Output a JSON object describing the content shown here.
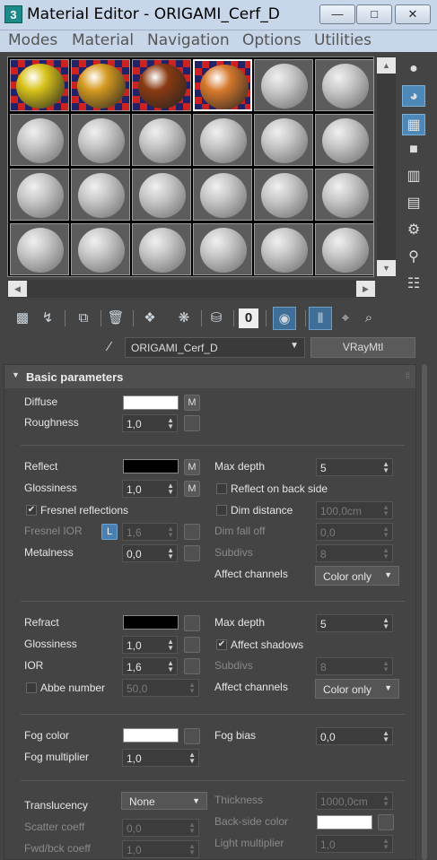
{
  "window": {
    "title": "Material Editor - ORIGAMI_Cerf_D",
    "icon": "3",
    "min": "—",
    "max": "□",
    "close": "✕"
  },
  "menu": [
    "Modes",
    "Material",
    "Navigation",
    "Options",
    "Utilities"
  ],
  "name_row": {
    "material_name": "ORIGAMI_Cerf_D",
    "material_type": "VRayMtl"
  },
  "rollout": {
    "title": "Basic parameters"
  },
  "params": {
    "diffuse": {
      "label": "Diffuse",
      "color": "#ffffff",
      "map": "M"
    },
    "roughness": {
      "label": "Roughness",
      "value": "1,0"
    },
    "reflect": {
      "label": "Reflect",
      "color": "#000000",
      "map": "M"
    },
    "glossiness": {
      "label": "Glossiness",
      "value": "1,0",
      "map": "M"
    },
    "fresnel": {
      "label": "Fresnel reflections",
      "checked": "✔"
    },
    "fresnel_ior": {
      "label": "Fresnel IOR",
      "lock": "L",
      "value": "1,6"
    },
    "metalness": {
      "label": "Metalness",
      "value": "0,0"
    },
    "refl_max_depth": {
      "label": "Max depth",
      "value": "5"
    },
    "reflect_back": {
      "label": "Reflect on back side"
    },
    "dim_distance": {
      "label": "Dim distance",
      "value": "100,0cm"
    },
    "dim_falloff": {
      "label": "Dim fall off",
      "value": "0,0"
    },
    "refl_subdivs": {
      "label": "Subdivs",
      "value": "8"
    },
    "refl_affect": {
      "label": "Affect channels",
      "value": "Color only"
    },
    "refract": {
      "label": "Refract",
      "color": "#000000"
    },
    "refr_gloss": {
      "label": "Glossiness",
      "value": "1,0"
    },
    "ior": {
      "label": "IOR",
      "value": "1,6"
    },
    "abbe": {
      "label": "Abbe number",
      "value": "50,0"
    },
    "refr_max_depth": {
      "label": "Max depth",
      "value": "5"
    },
    "affect_shadows": {
      "label": "Affect shadows",
      "checked": "✔"
    },
    "refr_subdivs": {
      "label": "Subdivs",
      "value": "8"
    },
    "refr_affect": {
      "label": "Affect channels",
      "value": "Color only"
    },
    "fog_color": {
      "label": "Fog color",
      "color": "#ffffff"
    },
    "fog_mult": {
      "label": "Fog multiplier",
      "value": "1,0"
    },
    "fog_bias": {
      "label": "Fog bias",
      "value": "0,0"
    },
    "translucency": {
      "label": "Translucency",
      "value": "None"
    },
    "scatter": {
      "label": "Scatter coeff",
      "value": "0,0"
    },
    "fwdbck": {
      "label": "Fwd/bck coeff",
      "value": "1,0"
    },
    "thickness": {
      "label": "Thickness",
      "value": "1000,0cm"
    },
    "backside": {
      "label": "Back-side color",
      "color": "#ffffff"
    },
    "light_mult": {
      "label": "Light multiplier",
      "value": "1,0"
    }
  },
  "slots": {
    "materials": [
      {
        "name": "slot-yellow",
        "color": "#d8c21a"
      },
      {
        "name": "slot-orange",
        "color": "#d59a20"
      },
      {
        "name": "slot-brown",
        "color": "#8a3a12"
      },
      {
        "name": "slot-selected-orange",
        "color": "#d6782c"
      }
    ]
  }
}
